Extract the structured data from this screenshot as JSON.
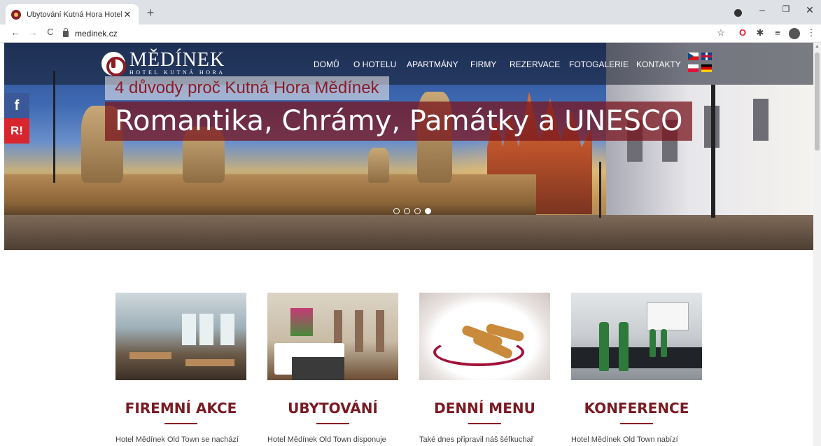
{
  "browser": {
    "tab_title": "Ubytování Kutná Hora Hotel Mě...",
    "tab_close": "✕",
    "new_tab": "+",
    "url": "medinek.cz",
    "nav_back": "←",
    "nav_forward": "→",
    "nav_reload": "C",
    "minimize": "–",
    "maximize": "❐",
    "close": "✕",
    "bookmark": "☆",
    "opera": "O",
    "extensions": "✱",
    "reading_list": "≡",
    "menu": "⋮"
  },
  "site": {
    "logo_name": "MĚDÍNEK",
    "logo_sub": "HOTEL KUTNÁ HORA",
    "nav": [
      "DOMŮ",
      "O HOTELU",
      "APARTMÁNY",
      "FIRMY",
      "REZERVACE",
      "FOTOGALERIE",
      "KONTAKTY"
    ],
    "languages": [
      "cz",
      "en",
      "pl",
      "de"
    ]
  },
  "social": {
    "facebook": "f",
    "other": "R!"
  },
  "hero": {
    "subtitle": "4 důvody proč Kutná Hora Mědínek",
    "title": "Romantika, Chrámy, Památky a UNESCO",
    "slide_count": 4,
    "active_slide": 4
  },
  "cards": [
    {
      "title": "FIREMNÍ AKCE",
      "text": "Hotel Mědínek Old Town se nachází"
    },
    {
      "title": "UBYTOVÁNÍ",
      "text": "Hotel Mědínek Old Town disponuje"
    },
    {
      "title": "DENNÍ MENU",
      "text": "Také dnes připravil náš šéfkuchař"
    },
    {
      "title": "KONFERENCE",
      "text": "Hotel Mědínek Old Town nabízí"
    }
  ],
  "colors": {
    "brand": "#8b1c24",
    "facebook": "#3b5998",
    "social_red": "#d9262e"
  }
}
